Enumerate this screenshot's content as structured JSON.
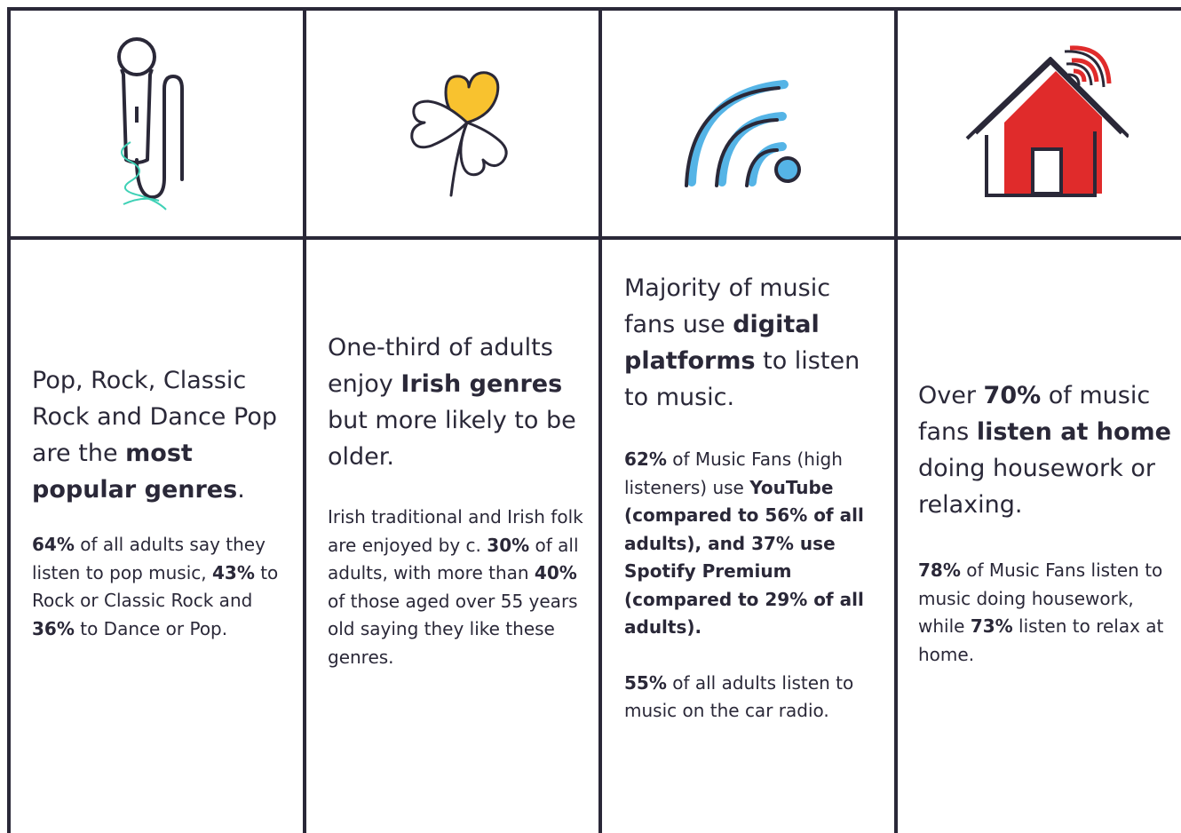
{
  "colors": {
    "ink": "#2a2838",
    "teal": "#3fd1b6",
    "yellow": "#f8c22f",
    "blue": "#55b4e6",
    "red": "#e02b2b"
  },
  "icons": [
    "microphone-icon",
    "shamrock-icon",
    "wifi-signal-icon",
    "smart-home-icon"
  ],
  "columns": [
    {
      "headline": {
        "parts": [
          {
            "t": "Pop, Rock, Classic Rock and Dance Pop are the ",
            "b": false
          },
          {
            "t": "most popular genres",
            "b": true
          },
          {
            "t": ".",
            "b": false
          }
        ]
      },
      "details": [
        {
          "parts": [
            {
              "t": "64%",
              "b": true
            },
            {
              "t": " of all adults say they listen to pop music, ",
              "b": false
            },
            {
              "t": "43%",
              "b": true
            },
            {
              "t": " to Rock or Classic Rock and ",
              "b": false
            },
            {
              "t": "36%",
              "b": true
            },
            {
              "t": " to Dance or Pop.",
              "b": false
            }
          ]
        }
      ]
    },
    {
      "headline": {
        "parts": [
          {
            "t": "One-third of adults enjoy ",
            "b": false
          },
          {
            "t": "Irish genres",
            "b": true
          },
          {
            "t": " but more likely to be older.",
            "b": false
          }
        ]
      },
      "details": [
        {
          "parts": [
            {
              "t": "Irish traditional and Irish folk are enjoyed by c. ",
              "b": false
            },
            {
              "t": "30%",
              "b": true
            },
            {
              "t": " of all adults, with more than ",
              "b": false
            },
            {
              "t": "40%",
              "b": true
            },
            {
              "t": " of those aged over 55 years old saying they like these genres.",
              "b": false
            }
          ]
        }
      ]
    },
    {
      "headline": {
        "parts": [
          {
            "t": "Majority of music fans use ",
            "b": false
          },
          {
            "t": "digital platforms",
            "b": true
          },
          {
            "t": " to listen to music.",
            "b": false
          }
        ]
      },
      "details": [
        {
          "parts": [
            {
              "t": "62%",
              "b": true
            },
            {
              "t": " of Music Fans (high listeners) use ",
              "b": false
            },
            {
              "t": "YouTube (compared to 56% of all adults), and 37% use Spotify Premium (compared to 29% of all adults).",
              "b": true
            }
          ]
        },
        {
          "parts": [
            {
              "t": "55%",
              "b": true
            },
            {
              "t": " of all adults listen to music on the car radio.",
              "b": false
            }
          ]
        }
      ]
    },
    {
      "headline": {
        "parts": [
          {
            "t": "Over ",
            "b": false
          },
          {
            "t": "70%",
            "b": true
          },
          {
            "t": " of music fans ",
            "b": false
          },
          {
            "t": "listen at home",
            "b": true
          },
          {
            "t": " doing housework or relaxing.",
            "b": false
          }
        ]
      },
      "details": [
        {
          "parts": [
            {
              "t": "78%",
              "b": true
            },
            {
              "t": " of Music Fans listen to music doing housework, while ",
              "b": false
            },
            {
              "t": "73%",
              "b": true
            },
            {
              "t": " listen to relax at home.",
              "b": false
            }
          ]
        }
      ]
    }
  ]
}
